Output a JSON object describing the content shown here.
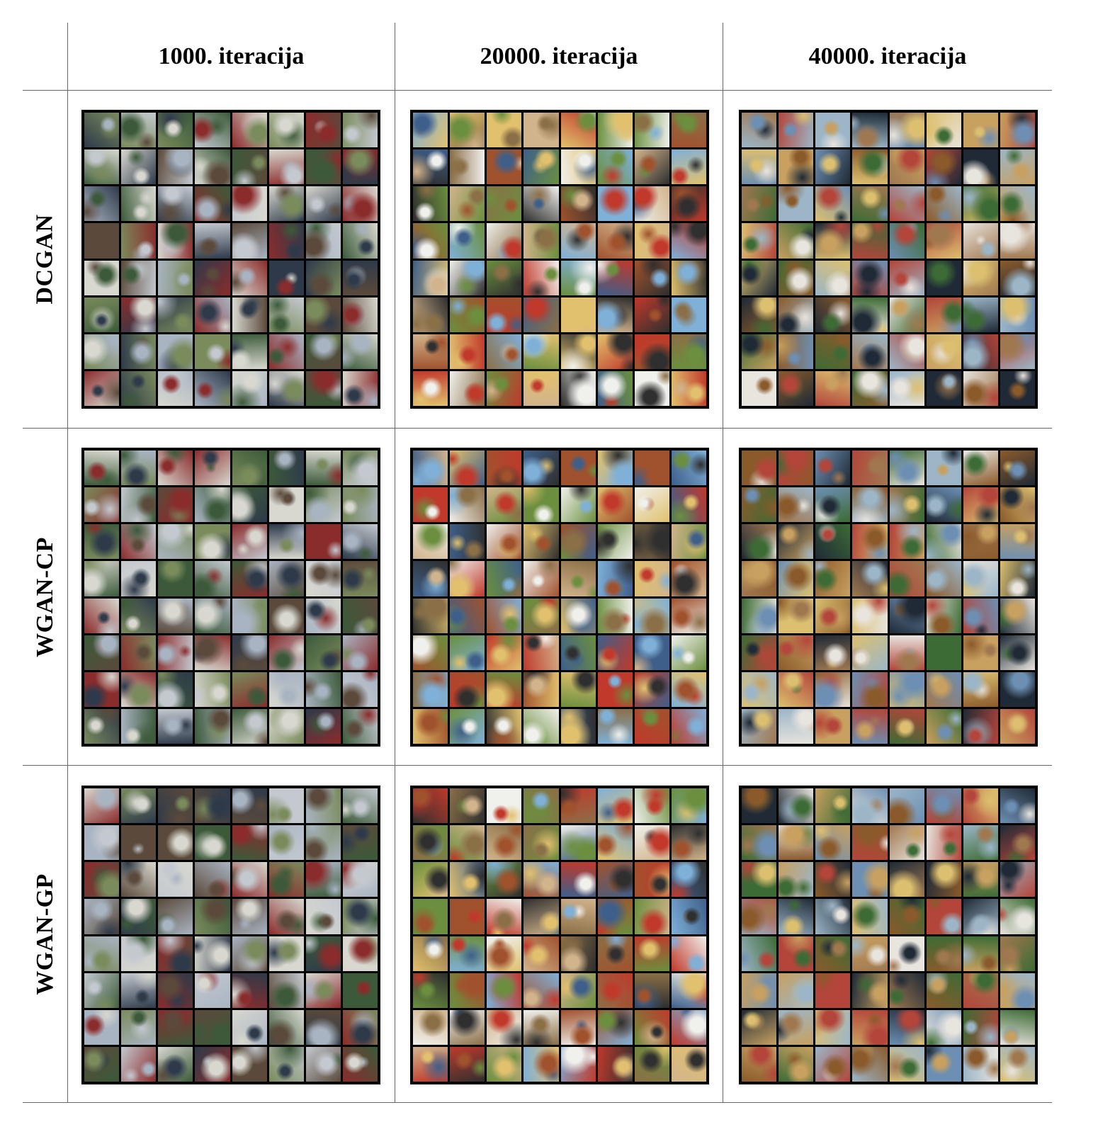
{
  "columns": [
    {
      "label": "1000. iteracija"
    },
    {
      "label": "20000. iteracija"
    },
    {
      "label": "40000. iteracija"
    }
  ],
  "rows": [
    {
      "label": "DCGAN"
    },
    {
      "label": "WGAN-CP"
    },
    {
      "label": "WGAN-GP"
    }
  ],
  "grid": {
    "rows": 8,
    "cols": 8
  }
}
